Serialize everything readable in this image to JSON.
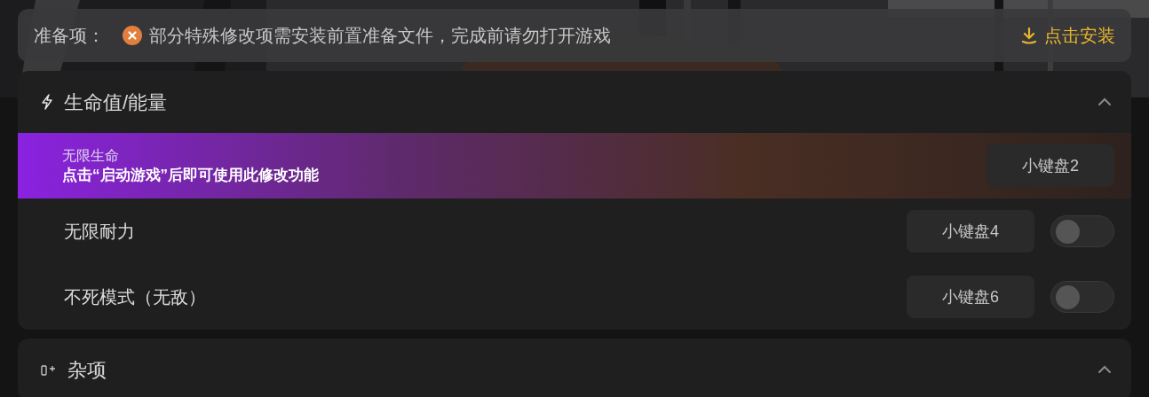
{
  "prep_bar": {
    "label": "准备项：",
    "message": "部分特殊修改项需安装前置准备文件，完成前请勿打开游戏",
    "install_button": "点击安装"
  },
  "sections": [
    {
      "title": "生命值/能量",
      "kind": "bolt",
      "expanded": true,
      "items": [
        {
          "kind": "notice",
          "name": "无限生命",
          "notice": "点击“启动游戏”后即可使用此修改功能",
          "hotkey": "小键盘2"
        },
        {
          "kind": "toggle",
          "name": "无限耐力",
          "hotkey": "小键盘4",
          "on": false
        },
        {
          "kind": "toggle",
          "name": "不死模式（无敌）",
          "hotkey": "小键盘6",
          "on": false
        }
      ]
    },
    {
      "title": "杂项",
      "kind": "misc",
      "expanded": true
    }
  ]
}
